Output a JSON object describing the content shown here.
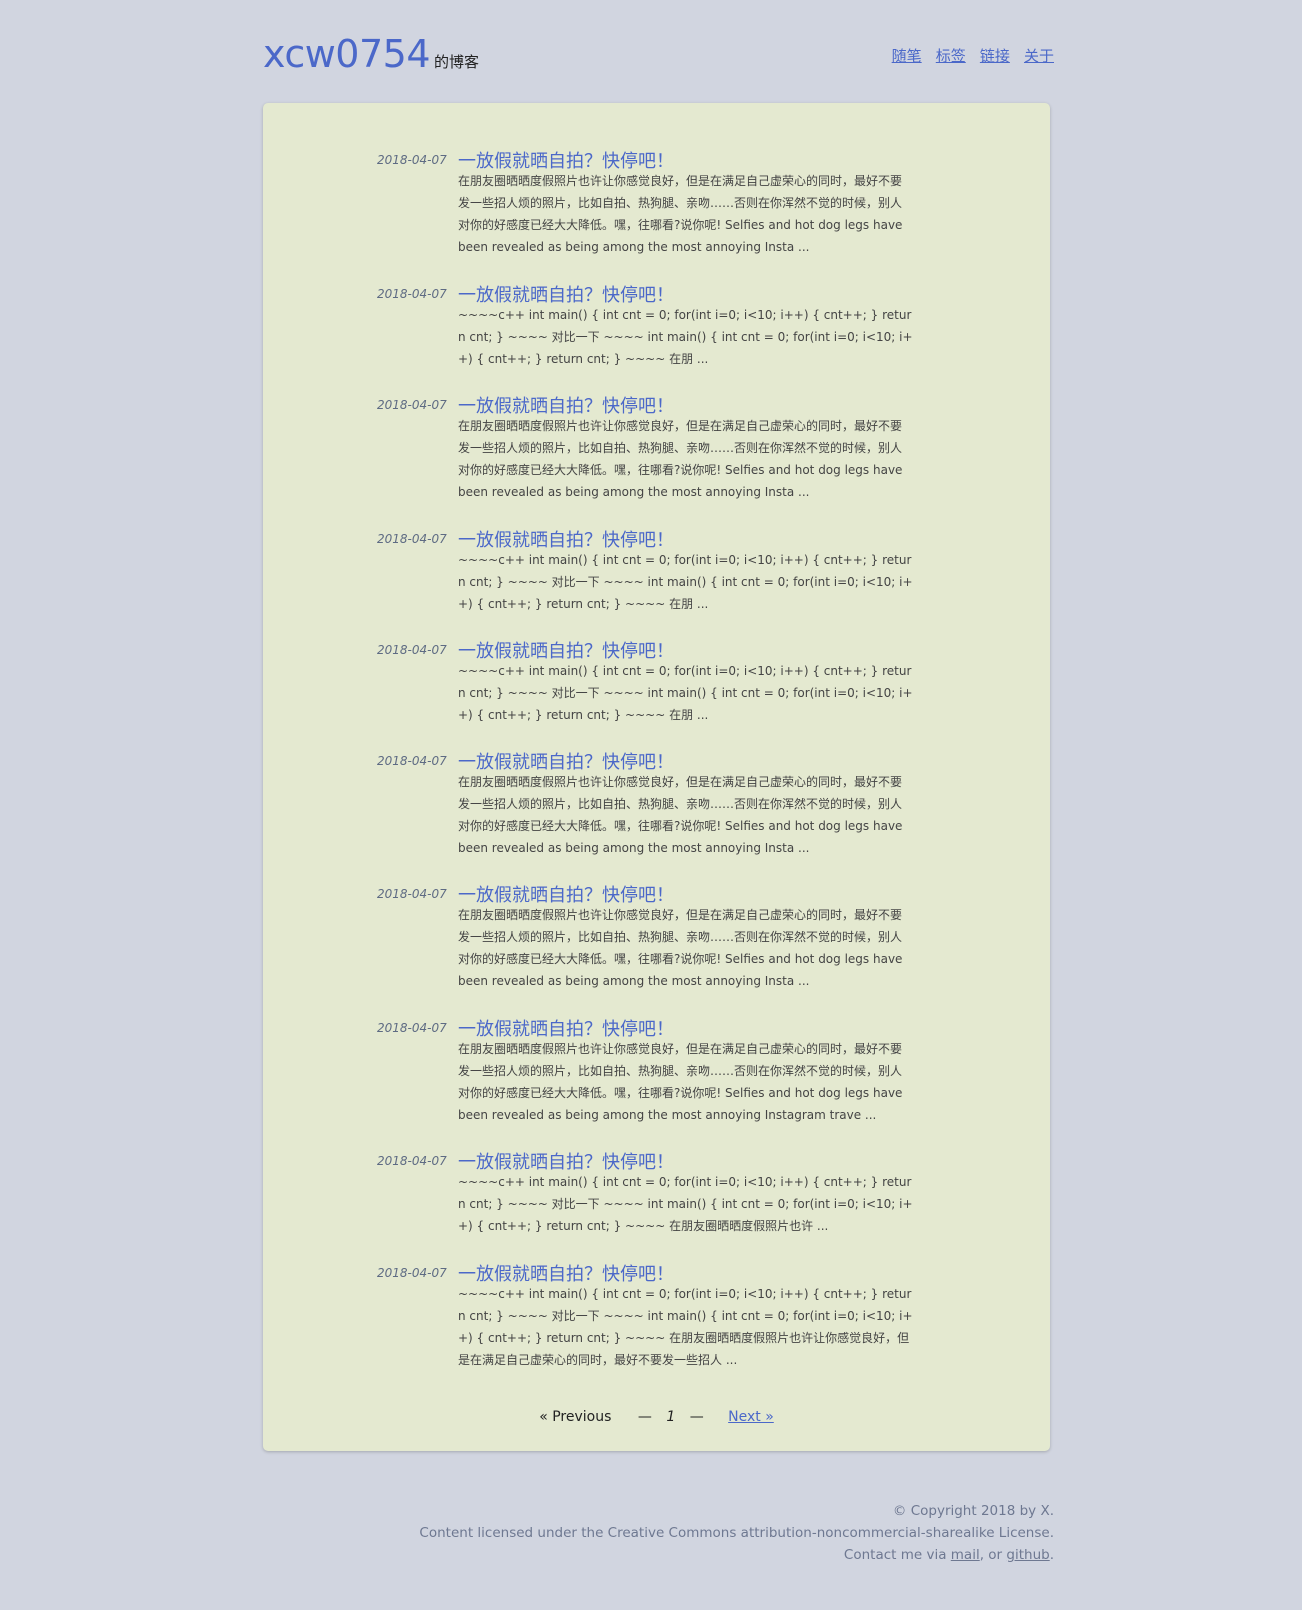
{
  "header": {
    "brand_name": "xcw0754",
    "brand_suffix": "的博客",
    "nav": [
      "随笔",
      "标签",
      "链接",
      "关于"
    ]
  },
  "posts": [
    {
      "date": "2018-04-07",
      "title": "一放假就晒自拍？快停吧！",
      "excerpt": "在朋友圈晒晒度假照片也许让你感觉良好，但是在满足自己虚荣心的同时，最好不要发一些招人烦的照片，比如自拍、热狗腿、亲吻……否则在你浑然不觉的时候，别人对你的好感度已经大大降低。嘿，往哪看?说你呢! Selfies and hot dog legs have been revealed as being among the most annoying Insta ..."
    },
    {
      "date": "2018-04-07",
      "title": "一放假就晒自拍？快停吧！",
      "excerpt": "~~~~c++ int main() { int cnt = 0; for(int i=0; i<10; i++) { cnt++; } return cnt; } ~~~~ 对比一下 ~~~~ int main() { int cnt = 0; for(int i=0; i<10; i++) { cnt++; } return cnt; } ~~~~ 在朋 ..."
    },
    {
      "date": "2018-04-07",
      "title": "一放假就晒自拍？快停吧！",
      "excerpt": "在朋友圈晒晒度假照片也许让你感觉良好，但是在满足自己虚荣心的同时，最好不要发一些招人烦的照片，比如自拍、热狗腿、亲吻……否则在你浑然不觉的时候，别人对你的好感度已经大大降低。嘿，往哪看?说你呢! Selfies and hot dog legs have been revealed as being among the most annoying Insta ..."
    },
    {
      "date": "2018-04-07",
      "title": "一放假就晒自拍？快停吧！",
      "excerpt": "~~~~c++ int main() { int cnt = 0; for(int i=0; i<10; i++) { cnt++; } return cnt; } ~~~~ 对比一下 ~~~~ int main() { int cnt = 0; for(int i=0; i<10; i++) { cnt++; } return cnt; } ~~~~ 在朋 ..."
    },
    {
      "date": "2018-04-07",
      "title": "一放假就晒自拍？快停吧！",
      "excerpt": "~~~~c++ int main() { int cnt = 0; for(int i=0; i<10; i++) { cnt++; } return cnt; } ~~~~ 对比一下 ~~~~ int main() { int cnt = 0; for(int i=0; i<10; i++) { cnt++; } return cnt; } ~~~~ 在朋 ..."
    },
    {
      "date": "2018-04-07",
      "title": "一放假就晒自拍？快停吧！",
      "excerpt": "在朋友圈晒晒度假照片也许让你感觉良好，但是在满足自己虚荣心的同时，最好不要发一些招人烦的照片，比如自拍、热狗腿、亲吻……否则在你浑然不觉的时候，别人对你的好感度已经大大降低。嘿，往哪看?说你呢! Selfies and hot dog legs have been revealed as being among the most annoying Insta ..."
    },
    {
      "date": "2018-04-07",
      "title": "一放假就晒自拍？快停吧！",
      "excerpt": "在朋友圈晒晒度假照片也许让你感觉良好，但是在满足自己虚荣心的同时，最好不要发一些招人烦的照片，比如自拍、热狗腿、亲吻……否则在你浑然不觉的时候，别人对你的好感度已经大大降低。嘿，往哪看?说你呢! Selfies and hot dog legs have been revealed as being among the most annoying Insta ..."
    },
    {
      "date": "2018-04-07",
      "title": "一放假就晒自拍？快停吧！",
      "excerpt": "在朋友圈晒晒度假照片也许让你感觉良好，但是在满足自己虚荣心的同时，最好不要发一些招人烦的照片，比如自拍、热狗腿、亲吻……否则在你浑然不觉的时候，别人对你的好感度已经大大降低。嘿，往哪看?说你呢! Selfies and hot dog legs have been revealed as being among the most annoying Instagram trave ..."
    },
    {
      "date": "2018-04-07",
      "title": "一放假就晒自拍？快停吧！",
      "excerpt": "~~~~c++ int main() { int cnt = 0; for(int i=0; i<10; i++) { cnt++; } return cnt; } ~~~~ 对比一下 ~~~~ int main() { int cnt = 0; for(int i=0; i<10; i++) { cnt++; } return cnt; } ~~~~ 在朋友圈晒晒度假照片也许 ..."
    },
    {
      "date": "2018-04-07",
      "title": "一放假就晒自拍？快停吧！",
      "excerpt": "~~~~c++ int main() { int cnt = 0; for(int i=0; i<10; i++) { cnt++; } return cnt; } ~~~~ 对比一下 ~~~~ int main() { int cnt = 0; for(int i=0; i<10; i++) { cnt++; } return cnt; } ~~~~ 在朋友圈晒晒度假照片也许让你感觉良好，但是在满足自己虚荣心的同时，最好不要发一些招人 ..."
    }
  ],
  "pager": {
    "previous": "« Previous",
    "dash": "—",
    "page": "1",
    "next": "Next »"
  },
  "footer": {
    "copyright": "© Copyright 2018 by X.",
    "license": "Content licensed under the Creative Commons attribution-noncommercial-sharealike License.",
    "contact_prefix": "Contact me via ",
    "mail": "mail",
    "or": ", or ",
    "github": "github",
    "end": "."
  }
}
